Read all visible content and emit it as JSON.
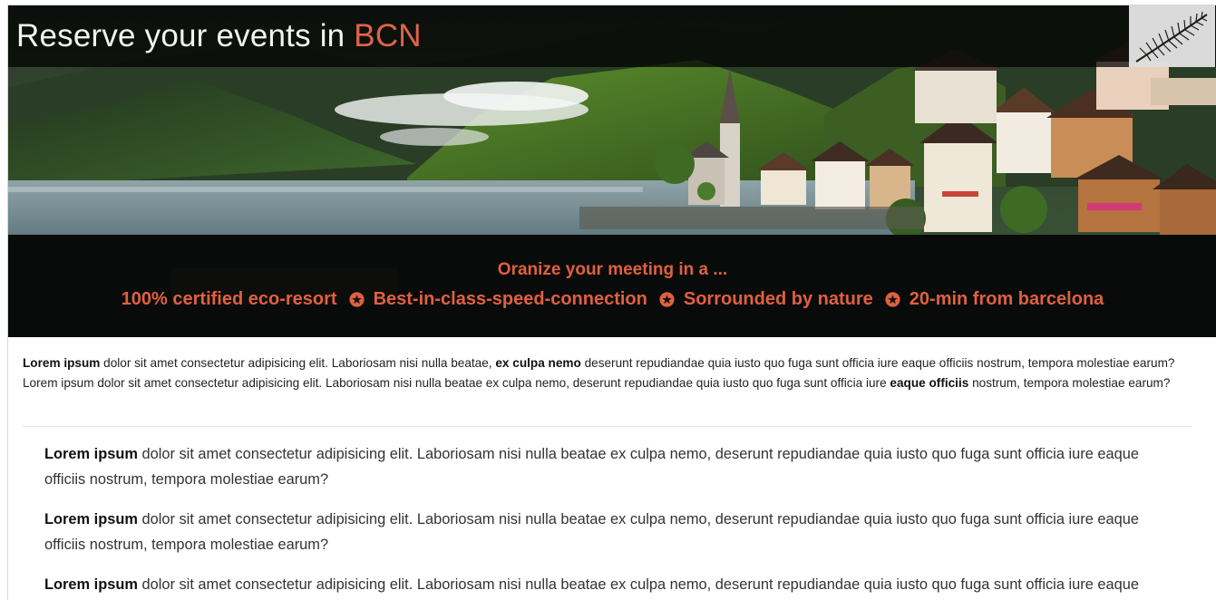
{
  "header": {
    "title_main": "Reserve your events in ",
    "title_accent": "BCN",
    "logo_icon": "fern-leaf-icon"
  },
  "hero": {
    "tagline": "Oranize your meeting in a ...",
    "features": [
      "100% certified eco-resort",
      "Best-in-class-speed-connection",
      "Sorrounded by nature",
      "20-min from barcelona"
    ],
    "separator_icon": "star-circle-icon",
    "accent_color": "#e0603f"
  },
  "intro": {
    "b1": "Lorem ipsum",
    "t1": " dolor sit amet consectetur adipisicing elit. Laboriosam nisi nulla beatae, ",
    "b2": "ex culpa nemo",
    "t2": " deserunt repudiandae quia iusto quo fuga sunt officia iure eaque officiis nostrum, tempora molestiae earum? Lorem ipsum dolor sit amet consectetur adipisicing elit. Laboriosam nisi nulla beatae ex culpa nemo, deserunt repudiandae quia iusto quo fuga sunt officia iure ",
    "b3": "eaque officiis",
    "t3": " nostrum, tempora molestiae earum?"
  },
  "paragraphs": [
    {
      "bold": "Lorem ipsum",
      "text": " dolor sit amet consectetur adipisicing elit. Laboriosam nisi nulla beatae ex culpa nemo, deserunt repudiandae quia iusto quo fuga sunt officia iure eaque officiis nostrum, tempora molestiae earum?"
    },
    {
      "bold": "Lorem ipsum",
      "text": " dolor sit amet consectetur adipisicing elit. Laboriosam nisi nulla beatae ex culpa nemo, deserunt repudiandae quia iusto quo fuga sunt officia iure eaque officiis nostrum, tempora molestiae earum?"
    },
    {
      "bold": "Lorem ipsum",
      "text": " dolor sit amet consectetur adipisicing elit. Laboriosam nisi nulla beatae ex culpa nemo, deserunt repudiandae quia iusto quo fuga sunt officia iure eaque"
    }
  ]
}
